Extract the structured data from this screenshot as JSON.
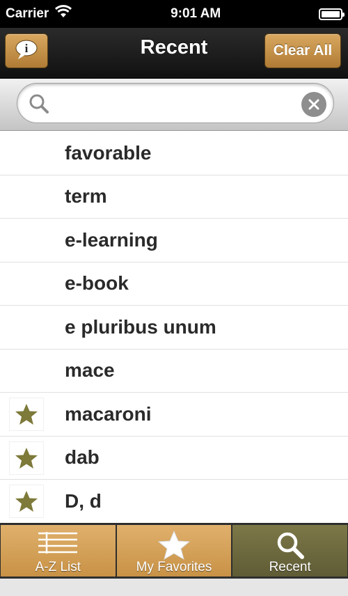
{
  "status_bar": {
    "carrier": "Carrier",
    "time": "9:01 AM",
    "wifi_icon": "wifi-icon",
    "battery_icon": "battery-icon"
  },
  "nav": {
    "title": "Recent",
    "info_icon": "info-bubble-icon",
    "clear_label": "Clear All"
  },
  "search": {
    "value": "",
    "placeholder": "",
    "search_icon": "search-icon",
    "clear_icon": "clear-icon"
  },
  "list": {
    "items": [
      {
        "word": "favorable",
        "favorite": false
      },
      {
        "word": "term",
        "favorite": false
      },
      {
        "word": "e-learning",
        "favorite": false
      },
      {
        "word": "e-book",
        "favorite": false
      },
      {
        "word": "e pluribus unum",
        "favorite": false
      },
      {
        "word": "mace",
        "favorite": false
      },
      {
        "word": "macaroni",
        "favorite": true
      },
      {
        "word": "dab",
        "favorite": true
      },
      {
        "word": "D, d",
        "favorite": true
      }
    ]
  },
  "tabs": [
    {
      "label": "A-Z List",
      "icon": "list-icon",
      "active": false
    },
    {
      "label": "My Favorites",
      "icon": "star-icon",
      "active": false
    },
    {
      "label": "Recent",
      "icon": "search-icon",
      "active": true
    }
  ],
  "colors": {
    "accent_gold": "#c89246",
    "active_tab": "#6e6a3e",
    "star_green": "#7d7a3a"
  }
}
